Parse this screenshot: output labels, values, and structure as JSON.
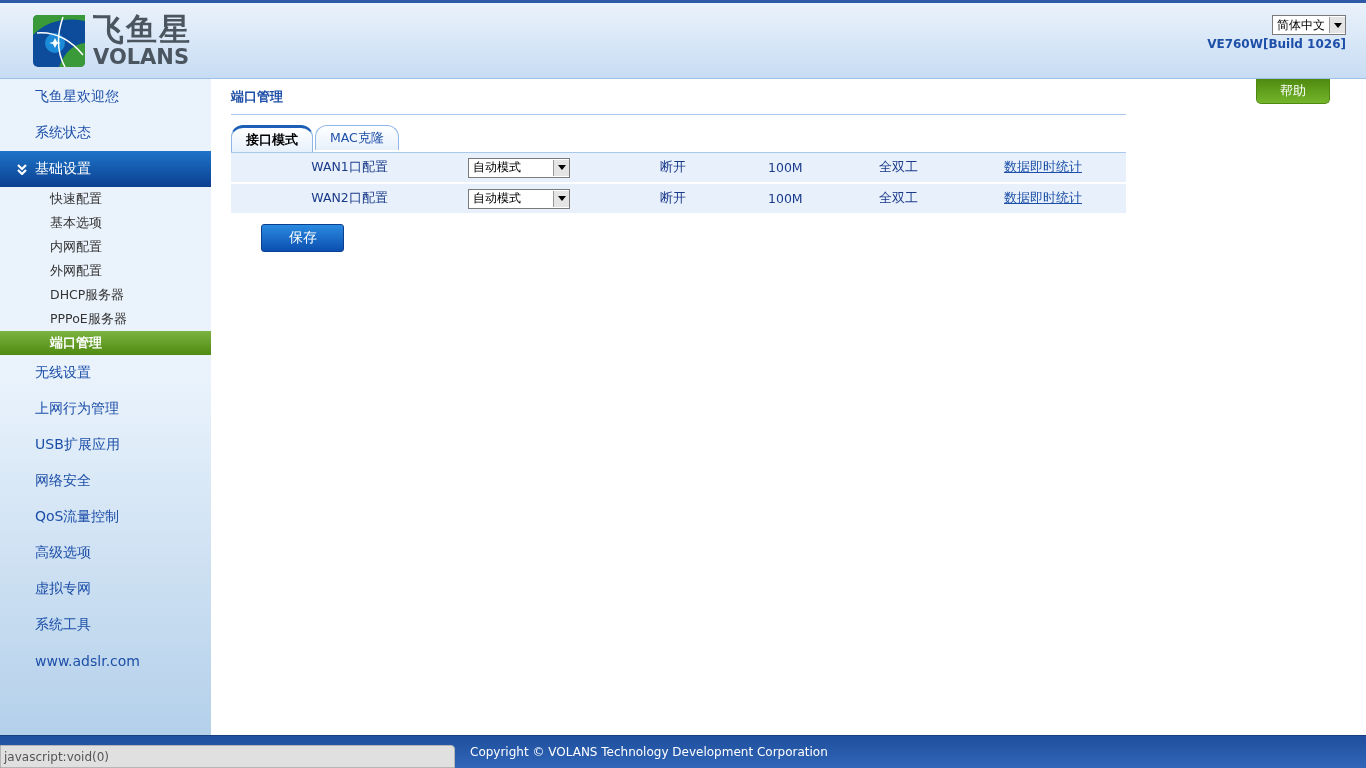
{
  "header": {
    "logo_cn": "飞鱼星",
    "logo_en": "VOLANS",
    "language": "简体中文",
    "version": "VE760W[Build 1026]"
  },
  "sidebar": {
    "items": [
      {
        "label": "飞鱼星欢迎您",
        "expanded": false
      },
      {
        "label": "系统状态",
        "expanded": false
      },
      {
        "label": "基础设置",
        "expanded": true,
        "children": [
          {
            "label": "快速配置",
            "selected": false
          },
          {
            "label": "基本选项",
            "selected": false
          },
          {
            "label": "内网配置",
            "selected": false
          },
          {
            "label": "外网配置",
            "selected": false
          },
          {
            "label": "DHCP服务器",
            "selected": false
          },
          {
            "label": "PPPoE服务器",
            "selected": false
          },
          {
            "label": "端口管理",
            "selected": true
          }
        ]
      },
      {
        "label": "无线设置",
        "expanded": false
      },
      {
        "label": "上网行为管理",
        "expanded": false
      },
      {
        "label": "USB扩展应用",
        "expanded": false
      },
      {
        "label": "网络安全",
        "expanded": false
      },
      {
        "label": "QoS流量控制",
        "expanded": false
      },
      {
        "label": "高级选项",
        "expanded": false
      },
      {
        "label": "虚拟专网",
        "expanded": false
      },
      {
        "label": "系统工具",
        "expanded": false
      },
      {
        "label": "www.adslr.com",
        "expanded": false
      }
    ]
  },
  "page": {
    "title": "端口管理",
    "help_button": "帮助",
    "tabs": [
      {
        "label": "接口模式",
        "selected": true
      },
      {
        "label": "MAC克隆",
        "selected": false
      }
    ],
    "rows": [
      {
        "name": "WAN1口配置",
        "mode": "自动模式",
        "status": "断开",
        "speed": "100M",
        "duplex": "全双工",
        "link": "数据即时统计"
      },
      {
        "name": "WAN2口配置",
        "mode": "自动模式",
        "status": "断开",
        "speed": "100M",
        "duplex": "全双工",
        "link": "数据即时统计"
      }
    ],
    "save_button": "保存"
  },
  "footer": {
    "copyright": "Copyright © VOLANS Technology Development Corporation"
  },
  "status_bubble": "javascript:void(0)"
}
